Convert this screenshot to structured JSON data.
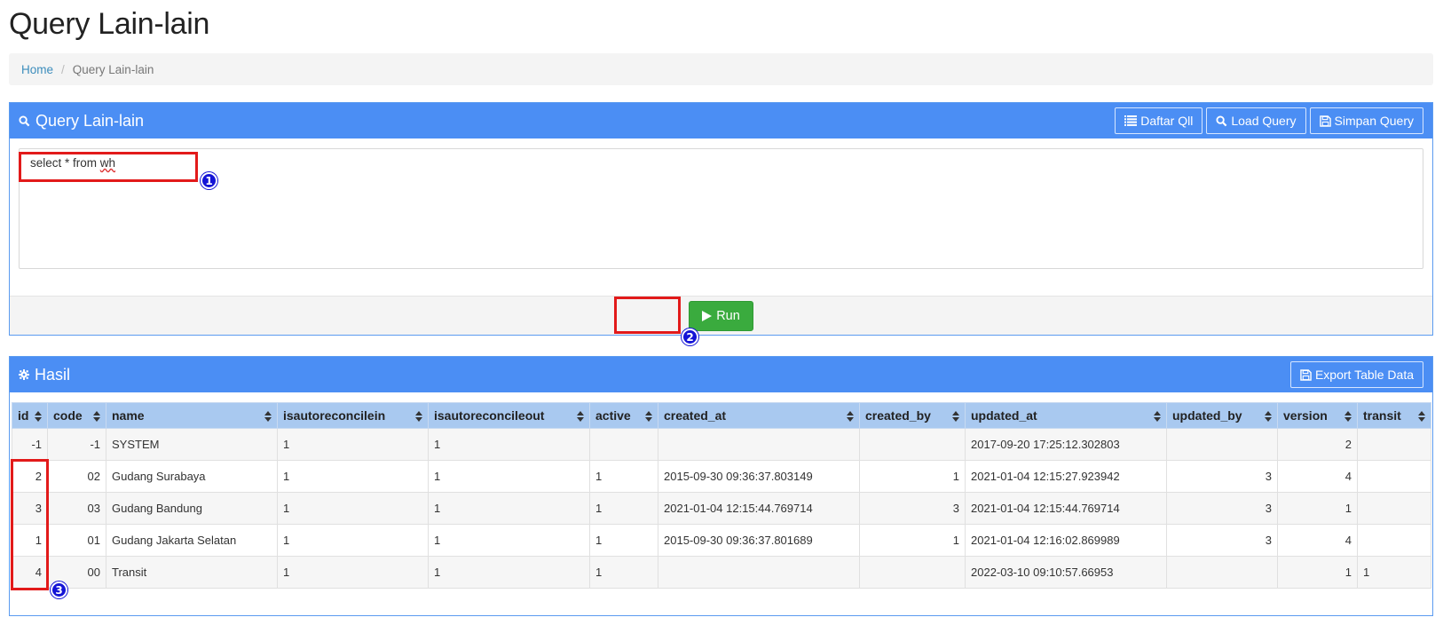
{
  "page": {
    "title": "Query Lain-lain"
  },
  "breadcrumb": {
    "home": "Home",
    "current": "Query Lain-lain"
  },
  "query_panel": {
    "title": "Query Lain-lain",
    "buttons": {
      "daftar": "Daftar Qll",
      "load": "Load Query",
      "simpan": "Simpan Query"
    },
    "query_prefix": "select * from ",
    "query_table": "wh",
    "run_label": "Run"
  },
  "result_panel": {
    "title": "Hasil",
    "export_label": "Export Table Data",
    "columns": [
      "id",
      "code",
      "name",
      "isautoreconcilein",
      "isautoreconcileout",
      "active",
      "created_at",
      "created_by",
      "updated_at",
      "updated_by",
      "version",
      "transit"
    ],
    "rows": [
      [
        "-1",
        "-1",
        "SYSTEM",
        "1",
        "1",
        "",
        "",
        "",
        "2017-09-20 17:25:12.302803",
        "",
        "2",
        ""
      ],
      [
        "2",
        "02",
        "Gudang Surabaya",
        "1",
        "1",
        "1",
        "2015-09-30 09:36:37.803149",
        "1",
        "2021-01-04 12:15:27.923942",
        "3",
        "4",
        ""
      ],
      [
        "3",
        "03",
        "Gudang Bandung",
        "1",
        "1",
        "1",
        "2021-01-04 12:15:44.769714",
        "3",
        "2021-01-04 12:15:44.769714",
        "3",
        "1",
        ""
      ],
      [
        "1",
        "01",
        "Gudang Jakarta Selatan",
        "1",
        "1",
        "1",
        "2015-09-30 09:36:37.801689",
        "1",
        "2021-01-04 12:16:02.869989",
        "3",
        "4",
        ""
      ],
      [
        "4",
        "00",
        "Transit",
        "1",
        "1",
        "1",
        "",
        "",
        "2022-03-10 09:10:57.66953",
        "",
        "1",
        "1"
      ]
    ]
  },
  "annotations": {
    "badge1": "1",
    "badge2": "2",
    "badge3": "3",
    "box_color": "#e21a1a",
    "badge_color": "#1414d6"
  },
  "colors": {
    "panel_header": "#4b8ef4",
    "run_button": "#3aab3e",
    "table_header": "#a9c9f0",
    "link": "#3c8dbc"
  }
}
